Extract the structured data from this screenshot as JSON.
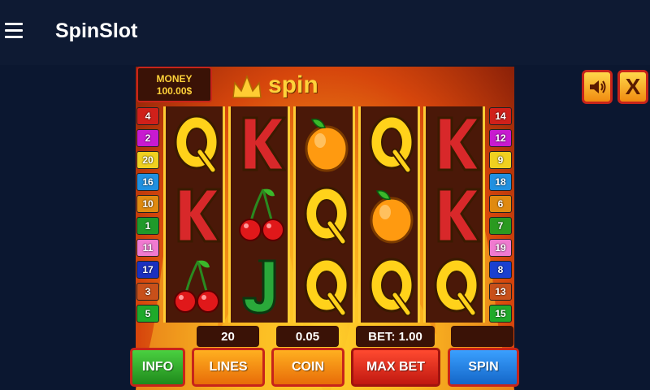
{
  "app": {
    "title": "SpinSlot"
  },
  "game": {
    "money_label": "MONEY",
    "money_value": "100.00$",
    "logo_text": "spin",
    "close_label": "X"
  },
  "paylines": {
    "left": [
      "4",
      "2",
      "20",
      "16",
      "10",
      "1",
      "11",
      "17",
      "3",
      "5"
    ],
    "right": [
      "14",
      "12",
      "9",
      "18",
      "6",
      "7",
      "19",
      "8",
      "13",
      "15"
    ]
  },
  "reels": [
    [
      "Q",
      "K",
      "cherry"
    ],
    [
      "K",
      "cherry",
      "J"
    ],
    [
      "orange",
      "Q",
      "Q"
    ],
    [
      "Q",
      "orange",
      "Q"
    ],
    [
      "K",
      "K",
      "Q"
    ]
  ],
  "stats": {
    "lines": "20",
    "coin": "0.05",
    "bet": "BET: 1.00",
    "win": ""
  },
  "buttons": {
    "info": "INFO",
    "lines": "LINES",
    "coin": "COIN",
    "max_bet": "MAX BET",
    "spin": "SPIN"
  },
  "colors": {
    "appbar": "#0e1a33",
    "background": "#0b1730",
    "gold": "#ffd23a",
    "info_btn": "#2ea82a",
    "lines_btn": "#f08a10",
    "coin_btn": "#f08a10",
    "maxbet_btn": "#e0281c",
    "spin_btn": "#1e86e8"
  }
}
